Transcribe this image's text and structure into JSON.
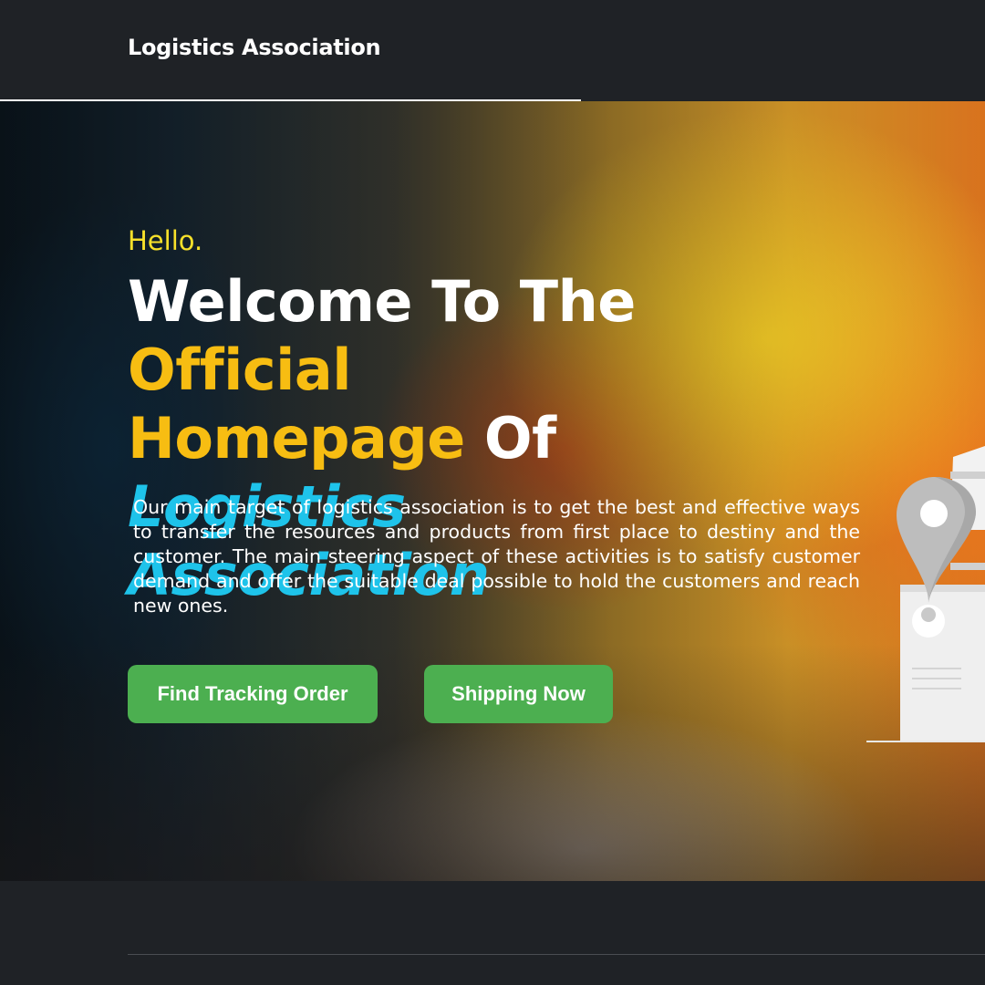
{
  "navbar": {
    "brand": "Logistics Association"
  },
  "hero": {
    "greeting": "Hello.",
    "headline": {
      "part1": "Welcome To The ",
      "part2": "Official",
      "part3": "Homepage",
      "part4": " Of ",
      "part5": "Logistics",
      "part6": "Association"
    },
    "description": "Our main target of logistics association is to get the best and effective ways to transfer the resources and products from first place to destiny and the customer. The main steering aspect of these activities is to satisfy customer demand and offer the suitable deal possible to hold the customers and reach new ones.",
    "buttons": {
      "track_label": "Find Tracking Order",
      "ship_label": "Shipping Now"
    },
    "illustration_icon": "location-pin-package-icon"
  },
  "colors": {
    "background": "#1f2226",
    "greeting": "#f8e12a",
    "headline_accent_yellow": "#f7bd12",
    "headline_accent_cyan": "#1ec3ea",
    "button": "#4caf50"
  }
}
